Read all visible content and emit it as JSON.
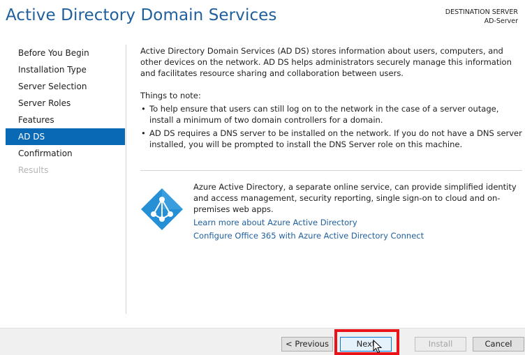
{
  "header": {
    "title": "Active Directory Domain Services",
    "destination_label": "DESTINATION SERVER",
    "destination_value": "AD-Server"
  },
  "sidebar": {
    "items": [
      {
        "label": "Before You Begin",
        "state": "normal"
      },
      {
        "label": "Installation Type",
        "state": "normal"
      },
      {
        "label": "Server Selection",
        "state": "normal"
      },
      {
        "label": "Server Roles",
        "state": "normal"
      },
      {
        "label": "Features",
        "state": "normal"
      },
      {
        "label": "AD DS",
        "state": "active"
      },
      {
        "label": "Confirmation",
        "state": "normal"
      },
      {
        "label": "Results",
        "state": "disabled"
      }
    ]
  },
  "main": {
    "intro": "Active Directory Domain Services (AD DS) stores information about users, computers, and other devices on the network.  AD DS helps administrators securely manage this information and facilitates resource sharing and collaboration between users.",
    "notes_title": "Things to note:",
    "notes": [
      "To help ensure that users can still log on to the network in the case of a server outage, install a minimum of two domain controllers for a domain.",
      "AD DS requires a DNS server to be installed on the network.  If you do not have a DNS server installed, you will be prompted to install the DNS Server role on this machine."
    ],
    "azure": {
      "icon": "azure-active-directory-icon",
      "description": "Azure Active Directory, a separate online service, can provide simplified identity and access management, security reporting, single sign-on to cloud and on-premises web apps.",
      "link_learn": "Learn more about Azure Active Directory",
      "link_configure": "Configure Office 365 with Azure Active Directory Connect"
    }
  },
  "footer": {
    "previous": "< Previous",
    "next": "Next",
    "install": "Install",
    "cancel": "Cancel"
  },
  "colors": {
    "title": "#1f5f9e",
    "active_nav": "#0a69b5",
    "link": "#1f5f9e",
    "highlight": "#e8141a",
    "azure_blue": "#2590d6"
  }
}
